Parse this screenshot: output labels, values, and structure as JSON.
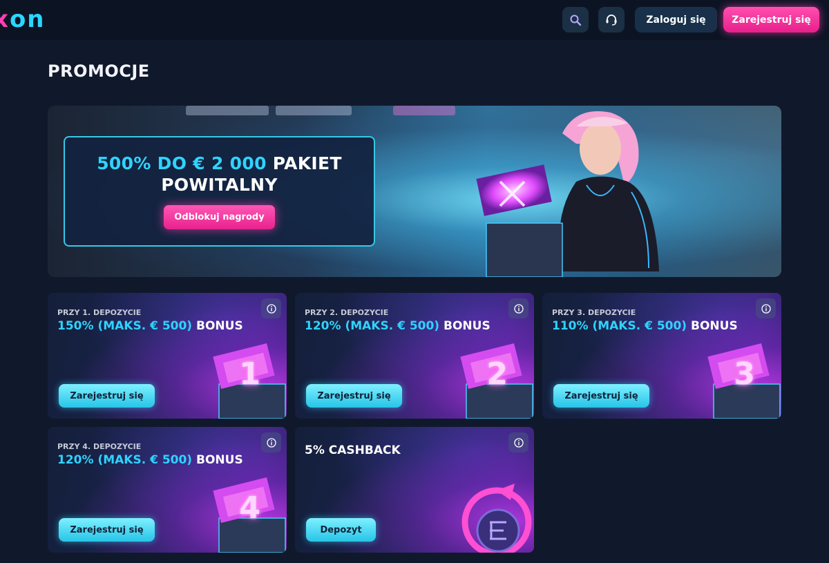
{
  "header": {
    "logo": {
      "x": "x",
      "on": "on"
    },
    "search_icon": "search-icon",
    "support_icon": "headset-icon",
    "login_label": "Zaloguj się",
    "register_label": "Zarejestruj się"
  },
  "page_title": "PROMOCJE",
  "hero": {
    "title_highlight": "500% DO € 2 000",
    "title_rest_line1": " PAKIET",
    "title_line2": "POWITALNY",
    "button_label": "Odblokuj nagrody"
  },
  "cards": [
    {
      "label": "PRZY 1. DEPOZYCIE",
      "title_highlight": "150% (MAKS. € 500)",
      "title_rest": " BONUS",
      "button_label": "Zarejestruj się",
      "gift_number": "1"
    },
    {
      "label": "PRZY 2. DEPOZYCIE",
      "title_highlight": "120% (MAKS. € 500)",
      "title_rest": " BONUS",
      "button_label": "Zarejestruj się",
      "gift_number": "2"
    },
    {
      "label": "PRZY 3. DEPOZYCIE",
      "title_highlight": "110% (MAKS. € 500)",
      "title_rest": " BONUS",
      "button_label": "Zarejestruj się",
      "gift_number": "3"
    },
    {
      "label": "PRZY 4. DEPOZYCIE",
      "title_highlight": "120% (MAKS. € 500)",
      "title_rest": " BONUS",
      "button_label": "Zarejestruj się",
      "gift_number": "4"
    },
    {
      "title": "5% CASHBACK",
      "button_label": "Depozyt"
    }
  ],
  "colors": {
    "accent_cyan": "#2fd3ff",
    "accent_pink": "#ff3fb4",
    "background": "#10192b"
  }
}
